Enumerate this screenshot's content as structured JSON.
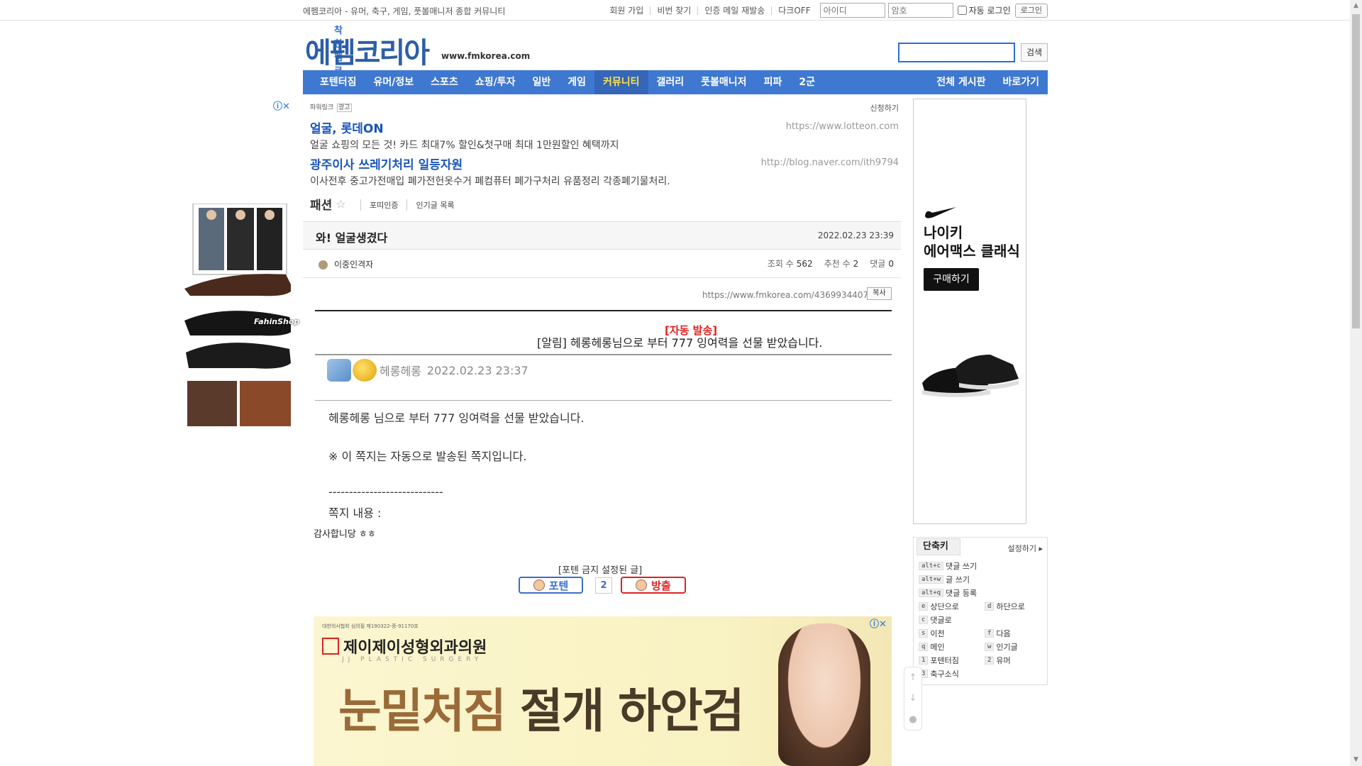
{
  "topbar": {
    "site_desc": "에펨코리아 - 유머, 축구, 게임, 풋볼매니저 종합 커뮤니티",
    "links": [
      "회원 가입",
      "비번 찾기",
      "인증 메일 재발송",
      "다크OFF"
    ],
    "id_placeholder": "아이디",
    "pw_placeholder": "암호",
    "auto_login": "자동 로그인",
    "login_button": "로그인"
  },
  "header": {
    "logo_small": "착한 펨코",
    "logo_big": "에펨코리아",
    "domain": "www.fmkorea.com",
    "search_button": "검색"
  },
  "nav": {
    "items": [
      "포텐터짐",
      "유머/정보",
      "스포츠",
      "쇼핑/투자",
      "일반",
      "게임",
      "커뮤니티",
      "갤러리",
      "풋볼매니저",
      "피파",
      "2군"
    ],
    "active_index": 6,
    "right_items": [
      "전체 게시판",
      "바로가기"
    ]
  },
  "powerlink": {
    "label": "파워링크",
    "ad_tag": "광고",
    "request": "신청하기",
    "items": [
      {
        "title": "얼굴, 롯데ON",
        "desc": "얼굴 쇼핑의 모든 것! 카드 최대7% 할인&첫구매 최대 1만원할인 혜택까지",
        "url": "https://www.lotteon.com"
      },
      {
        "title": "광주이사 쓰레기처리 일등자원",
        "desc": "이사전후 중고가전매입 폐가전헌옷수거 폐컴퓨터 폐가구처리 유품정리 각종폐기물처리.",
        "url": "http://blog.naver.com/ith9794"
      }
    ]
  },
  "board": {
    "name": "패션",
    "links": [
      "포띠인증",
      "인기글 목록"
    ]
  },
  "post": {
    "title": "와! 얼굴생겼다",
    "date": "2022.02.23 23:39",
    "author": "이중인격자",
    "views_label": "조회 수",
    "views": "562",
    "recommend_label": "추천 수",
    "recommend": "2",
    "comments_label": "댓글",
    "comments": "0",
    "url": "https://www.fmkorea.com/4369934407",
    "copy_label": "복사"
  },
  "message": {
    "auto_sent": "[자동 발송]",
    "notice": "[알림] 헤롱헤롱님으로 부터 777 잉여력을 선물 받았습니다.",
    "sender_nick": "헤롱헤롱",
    "sender_date": "2022.02.23 23:37",
    "line1": "헤롱헤롱 님으로 부터 777 잉여력을 선물 받았습니다.",
    "line2": "※ 이 쪽지는 자동으로 발송된 쪽지입니다.",
    "divider": "----------------------------",
    "line3": "쪽지 내용 :",
    "thanks": "감사합니당 ㅎㅎ"
  },
  "vote": {
    "label": "[포텐 금지 설정된 글]",
    "up_label": "포텐",
    "count": "2",
    "down_label": "방출"
  },
  "ads": {
    "left_brand": "FahinShop",
    "nike_brand": "나이키",
    "nike_product": "에어맥스 클래식",
    "nike_cta": "구매하기",
    "clinic_notice": "대한의사협회 심의필 제190322-중-91170호",
    "clinic_name": "제이제이성형외과의원",
    "clinic_sub": "JJ PLASTIC SURGERY",
    "headline_a": "눈밑처짐",
    "headline_b": "절개 하안검"
  },
  "shortcuts": {
    "tab": "단축키",
    "settings": "설정하기",
    "rows": [
      {
        "key": "alt+c",
        "label": "댓글 쓰기"
      },
      {
        "key": "alt+w",
        "label": "글 쓰기"
      },
      {
        "key": "alt+q",
        "label": "댓글 등록"
      }
    ],
    "pairs": [
      [
        {
          "key": "e",
          "label": "상단으로"
        },
        {
          "key": "d",
          "label": "하단으로"
        }
      ],
      [
        {
          "key": "c",
          "label": "댓글로"
        },
        null
      ],
      [
        {
          "key": "s",
          "label": "이전"
        },
        {
          "key": "f",
          "label": "다음"
        }
      ],
      [
        {
          "key": "q",
          "label": "메인"
        },
        {
          "key": "w",
          "label": "인기글"
        }
      ],
      [
        {
          "key": "1",
          "label": "포텐터짐"
        },
        {
          "key": "2",
          "label": "유머"
        }
      ],
      [
        {
          "key": "3",
          "label": "축구소식"
        },
        null
      ]
    ]
  },
  "colors": {
    "nav_bg": "#3f78d0",
    "nav_active_text": "#ffe44d",
    "link_blue": "#1a55b8",
    "alert_red": "#e12020"
  }
}
